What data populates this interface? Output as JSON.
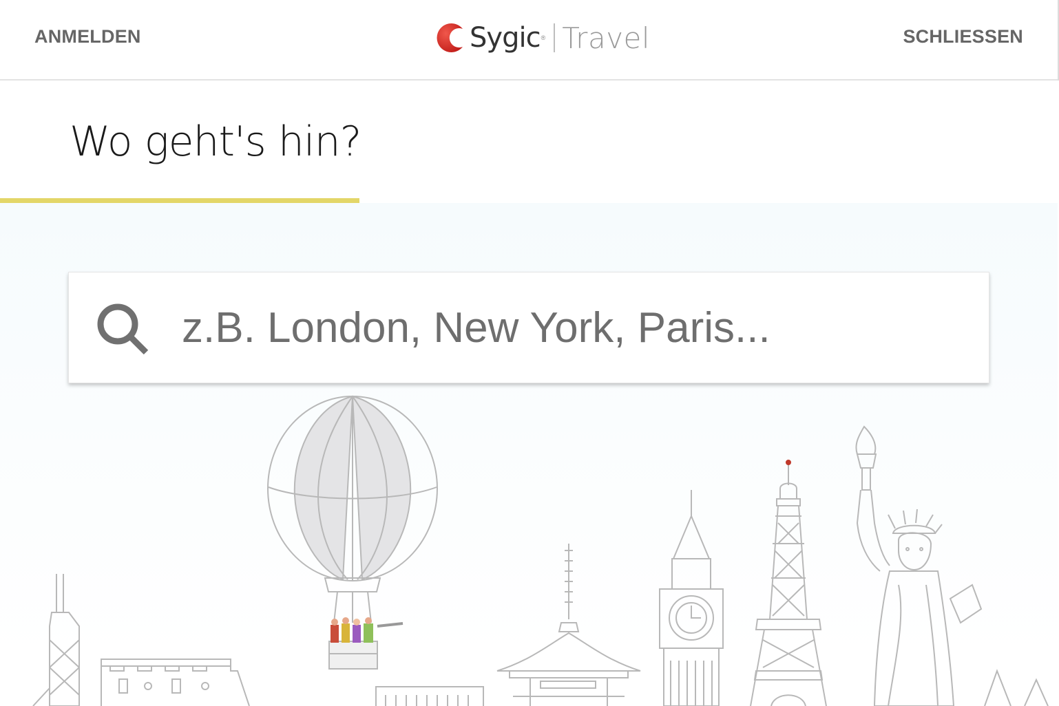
{
  "header": {
    "login_label": "ANMELDEN",
    "close_label": "SCHLIESSEN",
    "logo": {
      "brand": "Sygic",
      "registered_mark": "®",
      "product": "Travel"
    }
  },
  "main": {
    "title": "Wo geht's hin?",
    "search": {
      "placeholder": "z.B. London, New York, Paris...",
      "value": ""
    }
  },
  "colors": {
    "accent_underline": "#e3d668",
    "logo_red": "#d9322b",
    "illustration_line": "#b8b8b8"
  },
  "icons": {
    "search": "search-icon",
    "logo": "sygic-logo-icon"
  }
}
